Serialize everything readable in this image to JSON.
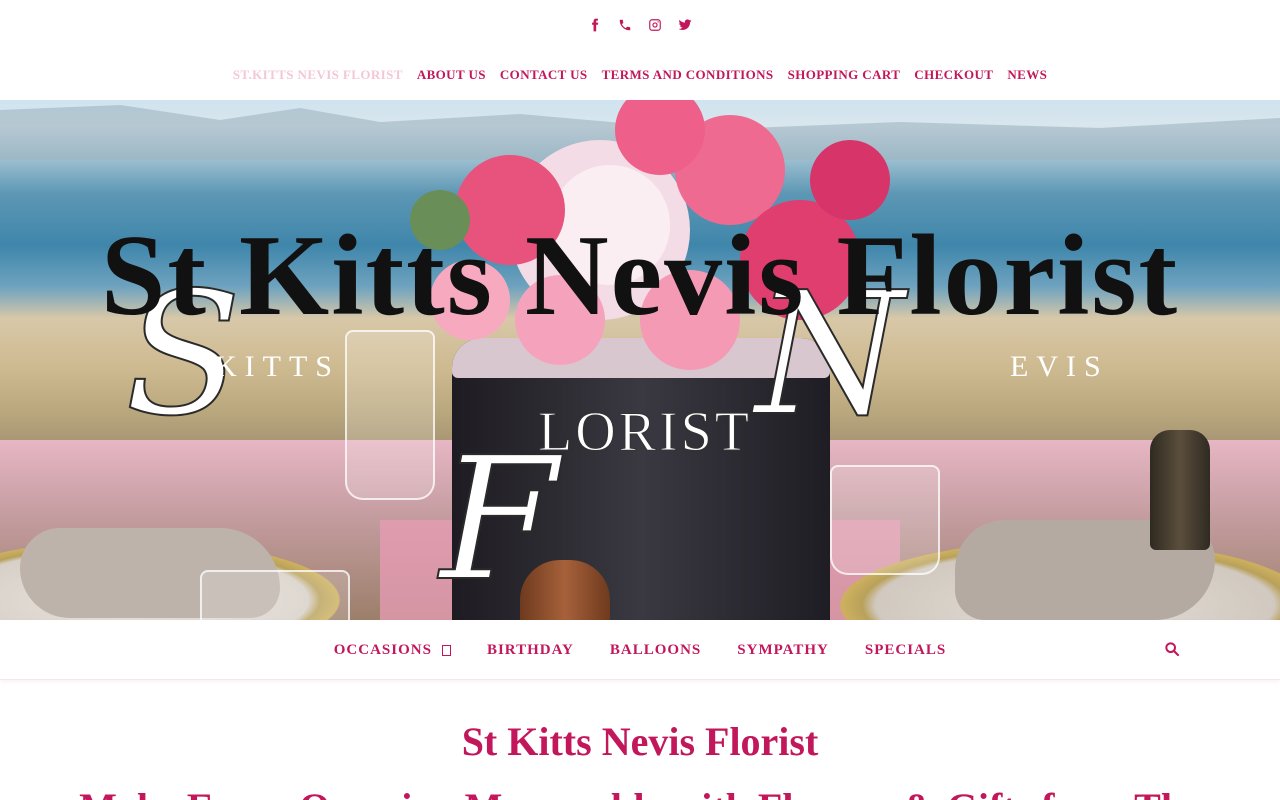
{
  "social": {
    "icons": [
      "facebook-icon",
      "phone-icon",
      "instagram-icon",
      "twitter-icon"
    ],
    "accent_color": "#c2185b"
  },
  "top_nav": {
    "items": [
      {
        "label": "ST.KITTS NEVIS FLORIST",
        "current": true
      },
      {
        "label": "ABOUT US"
      },
      {
        "label": "CONTACT US"
      },
      {
        "label": "TERMS AND CONDITIONS"
      },
      {
        "label": "SHOPPING CART"
      },
      {
        "label": "CHECKOUT"
      },
      {
        "label": "NEWS"
      }
    ]
  },
  "hero": {
    "site_title": "St Kitts Nevis Florist",
    "logo": {
      "letter_s": "S",
      "letter_n": "N",
      "letter_f": "F",
      "kitts": "KITTS",
      "evis": "EVIS",
      "florist": "LORIST"
    }
  },
  "main_nav": {
    "items": [
      {
        "label": "OCCASIONS",
        "has_dropdown": true
      },
      {
        "label": "BIRTHDAY"
      },
      {
        "label": "BALLOONS"
      },
      {
        "label": "SYMPATHY"
      },
      {
        "label": "SPECIALS"
      }
    ],
    "search_icon": "search-icon"
  },
  "content": {
    "heading": "St Kitts Nevis Florist",
    "subheading": "Make Every Occasion Memorable with Flowers & Gifts from The"
  }
}
